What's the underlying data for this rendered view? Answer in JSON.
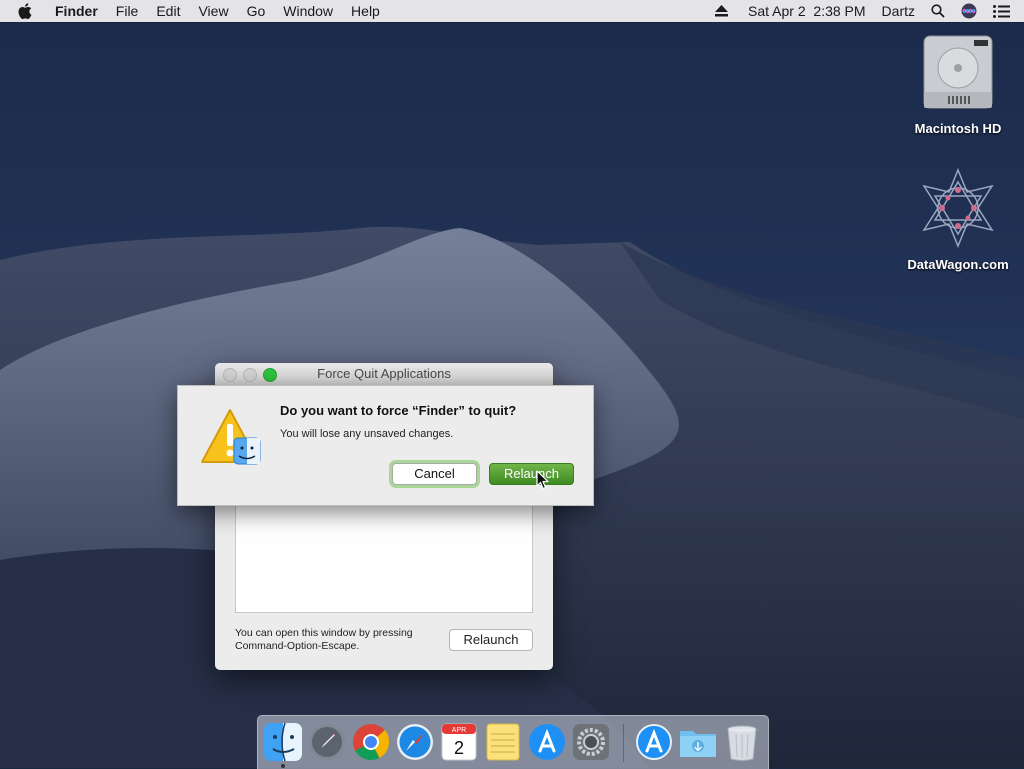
{
  "menubar": {
    "app_name": "Finder",
    "menus": [
      "File",
      "Edit",
      "View",
      "Go",
      "Window",
      "Help"
    ],
    "datetime": "Sat Apr 2  2:38 PM",
    "user": "Dartz"
  },
  "desktop": {
    "icons": [
      {
        "label": "Macintosh HD"
      },
      {
        "label": "DataWagon.com"
      }
    ]
  },
  "force_quit_window": {
    "title": "Force Quit Applications",
    "note_line1": "You can open this window by pressing",
    "note_line2": "Command-Option-Escape.",
    "relaunch_label": "Relaunch"
  },
  "alert": {
    "title": "Do you want to force “Finder” to quit?",
    "message": "You will lose any unsaved changes.",
    "cancel_label": "Cancel",
    "relaunch_label": "Relaunch"
  },
  "dock": {
    "apps": [
      "finder-icon",
      "launchpad-icon",
      "chrome-icon",
      "safari-icon",
      "calendar-icon",
      "notes-icon",
      "app-store-icon",
      "system-preferences-icon",
      "app-store-download-icon",
      "downloads-folder-icon",
      "trash-icon"
    ],
    "calendar_month": "APR",
    "calendar_day": "2"
  },
  "colors": {
    "accent_green": "#4a9a2f",
    "focus_ring": "#a9d79a"
  }
}
